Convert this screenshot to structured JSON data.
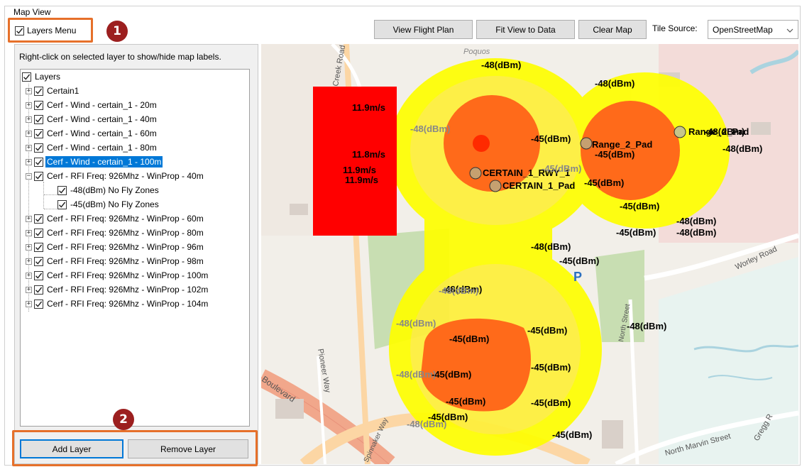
{
  "group_title": "Map View",
  "layers_menu": {
    "label": "Layers Menu",
    "checked": true
  },
  "badges": {
    "one": "1",
    "two": "2"
  },
  "toolbar": {
    "view_flight_plan": "View Flight Plan",
    "fit_view": "Fit View to Data",
    "clear_map": "Clear Map",
    "tile_source_label": "Tile Source:",
    "tile_source_value": "OpenStreetMap"
  },
  "panel": {
    "hint": "Right-click on selected layer to show/hide map labels.",
    "tree": [
      {
        "label": "Layers"
      },
      {
        "label": "Certain1"
      },
      {
        "label": "Cerf - Wind - certain_1 - 20m"
      },
      {
        "label": "Cerf - Wind - certain_1 - 40m"
      },
      {
        "label": "Cerf - Wind - certain_1 - 60m"
      },
      {
        "label": "Cerf - Wind - certain_1 - 80m"
      },
      {
        "label": "Cerf - Wind - certain_1 - 100m",
        "selected": true
      },
      {
        "label": "Cerf - RFI Freq: 926Mhz - WinProp - 40m",
        "expanded": true
      },
      {
        "label": "-48(dBm) No Fly Zones"
      },
      {
        "label": "-45(dBm) No Fly Zones"
      },
      {
        "label": "Cerf - RFI Freq: 926Mhz - WinProp - 60m"
      },
      {
        "label": "Cerf - RFI Freq: 926Mhz - WinProp - 80m"
      },
      {
        "label": "Cerf - RFI Freq: 926Mhz - WinProp - 96m"
      },
      {
        "label": "Cerf - RFI Freq: 926Mhz - WinProp - 98m"
      },
      {
        "label": "Cerf - RFI Freq: 926Mhz - WinProp - 100m"
      },
      {
        "label": "Cerf - RFI Freq: 926Mhz - WinProp - 102m"
      },
      {
        "label": "Cerf - RFI Freq: 926Mhz - WinProp - 104m"
      }
    ],
    "add_layer": "Add Layer",
    "remove_layer": "Remove Layer"
  },
  "map": {
    "labels": {
      "range_pad": "Range_2_Pad",
      "certain_rwy": "CERTAIN_1_RWY_1",
      "certain_pad": "CERTAIN_1_Pad",
      "dbm45": "-45(dBm)",
      "dbm48": "-48(dBm)",
      "wind1": "11.9m/s",
      "wind2": "11.8m/s",
      "wind3": "11.9m/s",
      "wind4": "11.9m/s"
    },
    "streets": {
      "creek_road": "Creek Road",
      "poquoson": "Poquos",
      "worley_road": "Worley Road",
      "pioneer_way": "Pioneer Way",
      "boulevard": "Boulevard",
      "north_marvin": "North Marvin Street",
      "north_street": "North Street",
      "spinnaker": "Spinnaker Way",
      "gregg": "Gregg R"
    },
    "colors": {
      "high": "#ff0000",
      "mid": "#ff6a1a",
      "low": "#ffff00",
      "road_major": "#f1a78b",
      "road_trunk": "#fcd6a4",
      "park": "#c8deb2",
      "water": "#aad3df"
    },
    "parking_symbol": "P"
  }
}
